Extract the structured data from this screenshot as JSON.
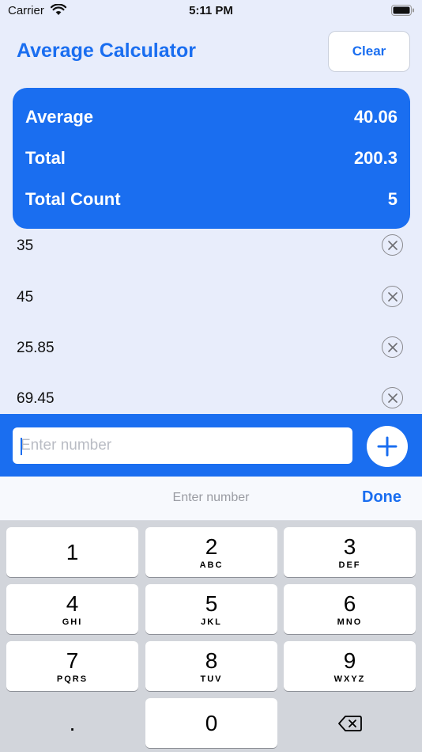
{
  "status_bar": {
    "carrier": "Carrier",
    "time": "5:11 PM"
  },
  "header": {
    "title": "Average Calculator",
    "clear_label": "Clear"
  },
  "summary": {
    "average_label": "Average",
    "average_value": "40.06",
    "total_label": "Total",
    "total_value": "200.3",
    "count_label": "Total Count",
    "count_value": "5"
  },
  "list": {
    "items": [
      "35",
      "45",
      "25.85",
      "69.45"
    ]
  },
  "input": {
    "placeholder": "Enter number",
    "value": ""
  },
  "accessory": {
    "placeholder": "Enter number",
    "done_label": "Done"
  },
  "keypad": {
    "keys": [
      {
        "digit": "1",
        "letters": ""
      },
      {
        "digit": "2",
        "letters": "ABC"
      },
      {
        "digit": "3",
        "letters": "DEF"
      },
      {
        "digit": "4",
        "letters": "GHI"
      },
      {
        "digit": "5",
        "letters": "JKL"
      },
      {
        "digit": "6",
        "letters": "MNO"
      },
      {
        "digit": "7",
        "letters": "PQRS"
      },
      {
        "digit": "8",
        "letters": "TUV"
      },
      {
        "digit": "9",
        "letters": "WXYZ"
      },
      {
        "digit": ".",
        "letters": ""
      },
      {
        "digit": "0",
        "letters": ""
      }
    ],
    "delete_icon": "backspace-icon"
  },
  "colors": {
    "accent": "#1a6ef0",
    "background": "#e8edfb",
    "keypad_bg": "#d2d5db"
  }
}
